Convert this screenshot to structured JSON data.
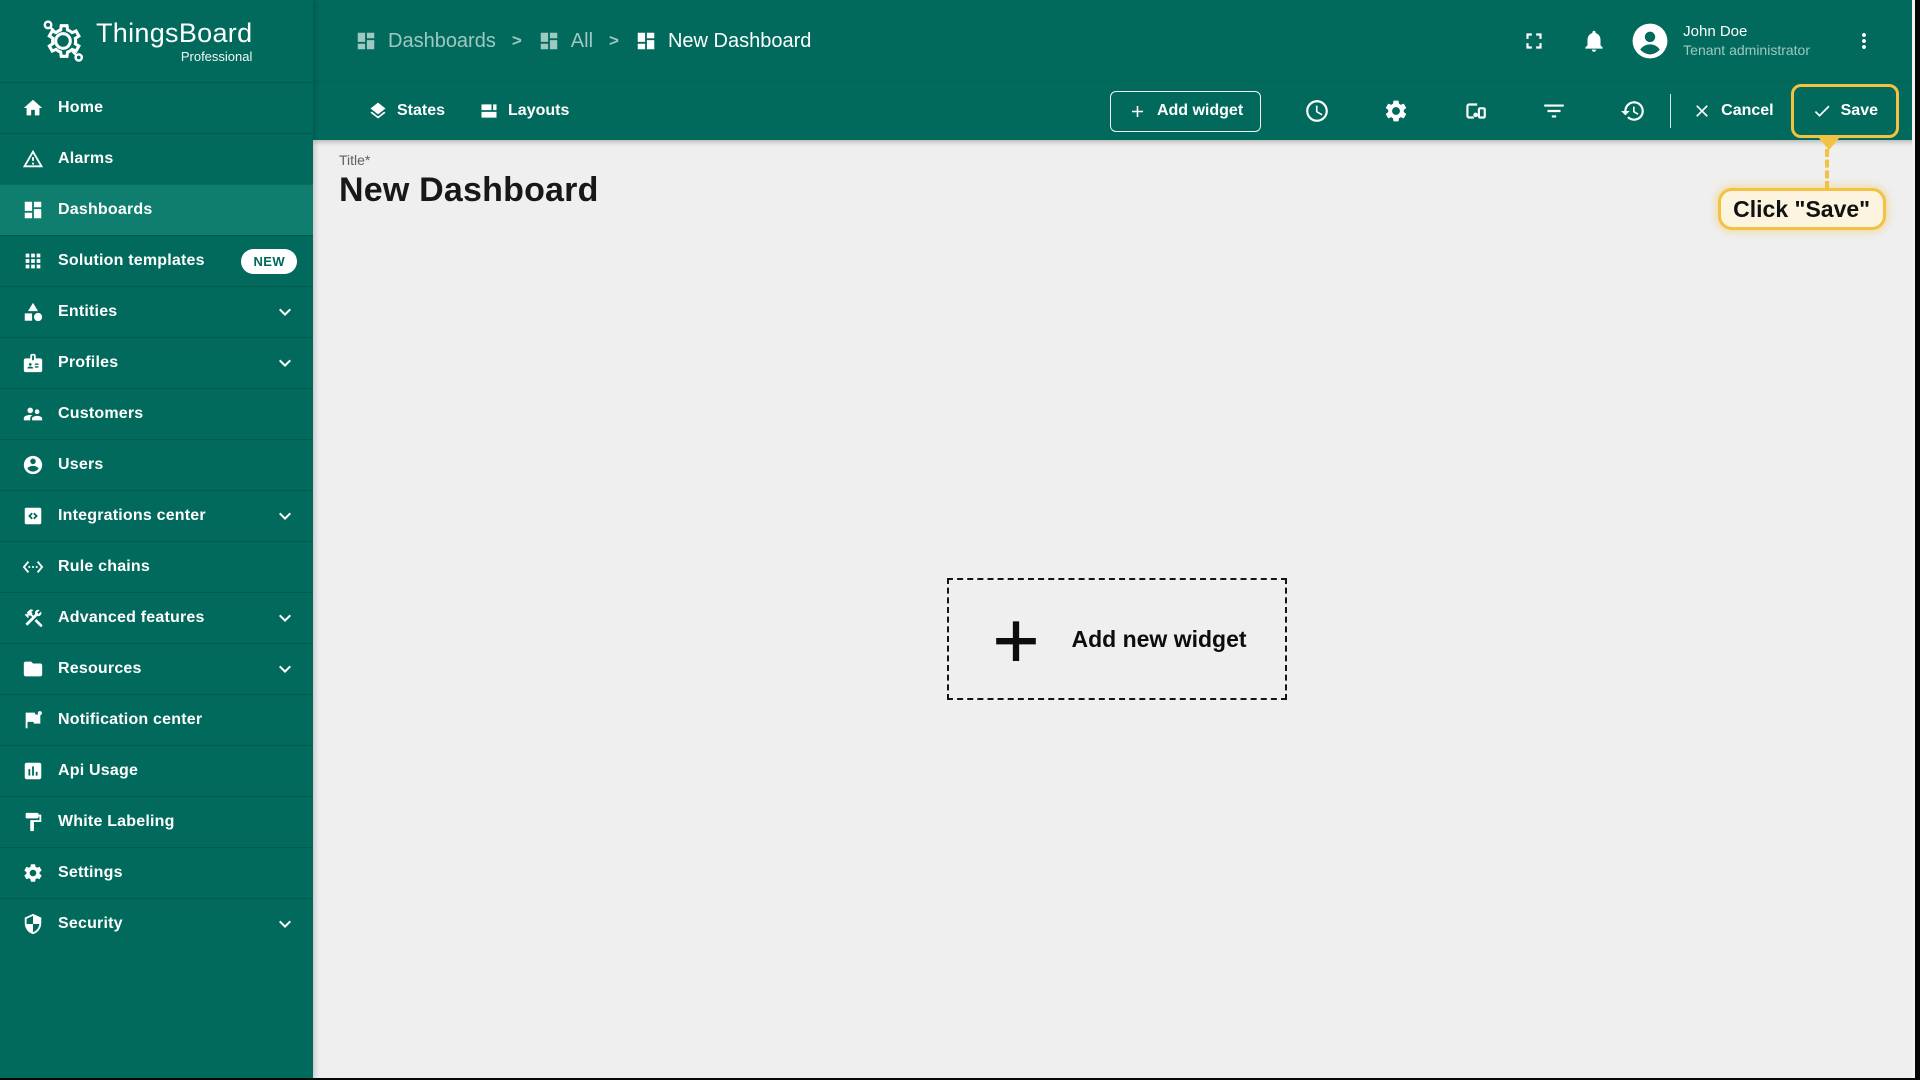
{
  "app": {
    "brand": "ThingsBoard",
    "brand_sub": "Professional"
  },
  "header": {
    "breadcrumb": [
      {
        "label": "Dashboards",
        "icon": "dashboard-icon"
      },
      {
        "label": "All",
        "icon": "dashboard-icon"
      },
      {
        "label": "New Dashboard",
        "icon": "dashboard-icon"
      }
    ],
    "breadcrumb_separator": ">",
    "icons": [
      "fullscreen-icon",
      "bell-icon",
      "kebab-menu-icon"
    ],
    "user": {
      "name": "John Doe",
      "role": "Tenant administrator",
      "avatar_icon": "person-icon"
    }
  },
  "toolbar": {
    "states_label": "States",
    "layouts_label": "Layouts",
    "add_widget_label": "Add widget",
    "icon_buttons": [
      "clock-icon",
      "gear-icon",
      "devices-icon",
      "filter-icon",
      "history-icon"
    ],
    "cancel_label": "Cancel",
    "save_label": "Save"
  },
  "sidebar": {
    "items": [
      {
        "label": "Home",
        "icon": "home-icon"
      },
      {
        "label": "Alarms",
        "icon": "warning-icon"
      },
      {
        "label": "Dashboards",
        "icon": "dashboards-icon",
        "active": true
      },
      {
        "label": "Solution templates",
        "icon": "apps-grid-icon",
        "badge": "NEW"
      },
      {
        "label": "Entities",
        "icon": "shapes-icon",
        "expandable": true
      },
      {
        "label": "Profiles",
        "icon": "id-badge-icon",
        "expandable": true
      },
      {
        "label": "Customers",
        "icon": "people-icon"
      },
      {
        "label": "Users",
        "icon": "person-circle-icon"
      },
      {
        "label": "Integrations center",
        "icon": "integration-icon",
        "expandable": true
      },
      {
        "label": "Rule chains",
        "icon": "code-brackets-icon"
      },
      {
        "label": "Advanced features",
        "icon": "tools-icon",
        "expandable": true
      },
      {
        "label": "Resources",
        "icon": "folder-icon",
        "expandable": true
      },
      {
        "label": "Notification center",
        "icon": "flag-icon"
      },
      {
        "label": "Api Usage",
        "icon": "bar-chart-box-icon"
      },
      {
        "label": "White Labeling",
        "icon": "paint-roller-icon"
      },
      {
        "label": "Settings",
        "icon": "gear-icon"
      },
      {
        "label": "Security",
        "icon": "shield-icon",
        "expandable": true
      }
    ]
  },
  "main": {
    "title_label": "Title*",
    "title_value": "New Dashboard",
    "add_widget_placeholder": "Add new widget"
  },
  "annotation": {
    "tooltip": "Click \"Save\""
  },
  "colors": {
    "primary": "#026a5d",
    "primary_light": "#0f7e6e",
    "content_bg": "#efefef",
    "accent": "#f2c240",
    "tooltip_bg": "#fcf4df",
    "text_muted": "#9dc9c1",
    "badge_text": "#02685c"
  }
}
